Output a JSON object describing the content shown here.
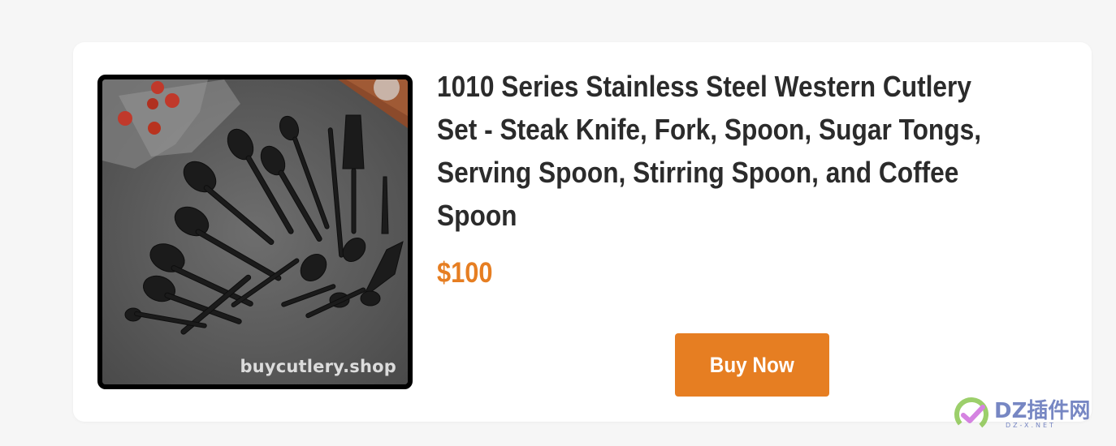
{
  "product": {
    "title": "1010 Series Stainless Steel Western Cutlery Set - Steak Knife, Fork, Spoon, Sugar Tongs, Serving Spoon, Stirring Spoon, and Coffee Spoon",
    "price": "$100",
    "buy_label": "Buy Now",
    "image_watermark": "buycutlery.shop"
  },
  "site_logo": {
    "text": "DZ插件网",
    "subtext": "DZ-X.NET"
  },
  "colors": {
    "accent": "#e67e22",
    "title": "#2b2b2b",
    "card_bg": "#ffffff",
    "page_bg": "#f6f6f6"
  }
}
